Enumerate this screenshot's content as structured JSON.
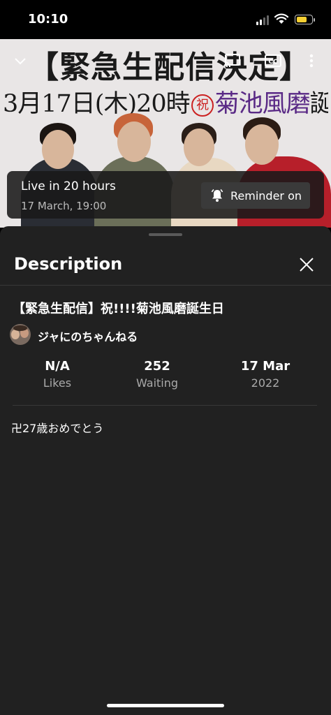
{
  "status_bar": {
    "time": "10:10"
  },
  "player": {
    "banner_line1": "【緊急生配信決定】",
    "banner_line2_part1": "3月17日(木)20時",
    "banner_celebrate": "祝",
    "banner_name": "菊池風磨",
    "banner_line2_part2": "誕生日記念",
    "icons": [
      "chevron-down-icon",
      "cast-icon",
      "captions-icon",
      "more-vert-icon"
    ]
  },
  "live_card": {
    "title": "Live in 20 hours",
    "date": "17 March, 19:00",
    "reminder_label": "Reminder on"
  },
  "sheet": {
    "title": "Description",
    "video_title": "【緊急生配信】祝!!!!菊池風磨誕生日",
    "channel_name": "ジャにのちゃんねる",
    "stats": [
      {
        "value": "N/A",
        "label": "Likes"
      },
      {
        "value": "252",
        "label": "Waiting"
      },
      {
        "value": "17 Mar",
        "label": "2022"
      }
    ],
    "description": "卍27歳おめでとう"
  },
  "colors": {
    "sheet_bg": "#212121",
    "accent_battery": "#f7d033"
  }
}
